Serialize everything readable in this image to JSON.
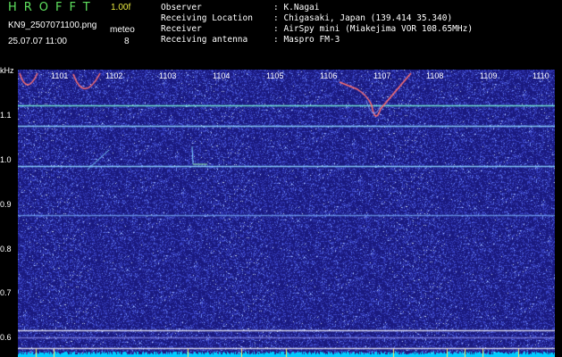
{
  "header": {
    "logo": "HROFFT",
    "version": "1.00f",
    "filename": "KN9_2507071100.png",
    "meteor_label": "meteo",
    "timestamp": "25.07.07 11:00",
    "meteor_count": "8"
  },
  "station_info": [
    {
      "key": "Observer",
      "value": ": K.Nagai"
    },
    {
      "key": "Receiving Location",
      "value": ": Chigasaki, Japan (139.414 35.340)"
    },
    {
      "key": "Receiver",
      "value": ": AirSpy mini (Miakejima VOR 108.65MHz)"
    },
    {
      "key": "Receiving antenna",
      "value": ": Maspro FM-3"
    }
  ],
  "axes": {
    "y_unit": "kHz",
    "y_ticks": [
      "1.1",
      "1.0",
      "0.9",
      "0.8",
      "0.7",
      "0.6"
    ],
    "x_ticks": [
      "1101",
      "1102",
      "1103",
      "1104",
      "1105",
      "1106",
      "1107",
      "1108",
      "1109",
      "1110"
    ]
  },
  "colors": {
    "background": "#1a1a80",
    "noise": "#5a6aff",
    "carrier": "#7fd8ff",
    "bottom_band": "#00ccff"
  }
}
